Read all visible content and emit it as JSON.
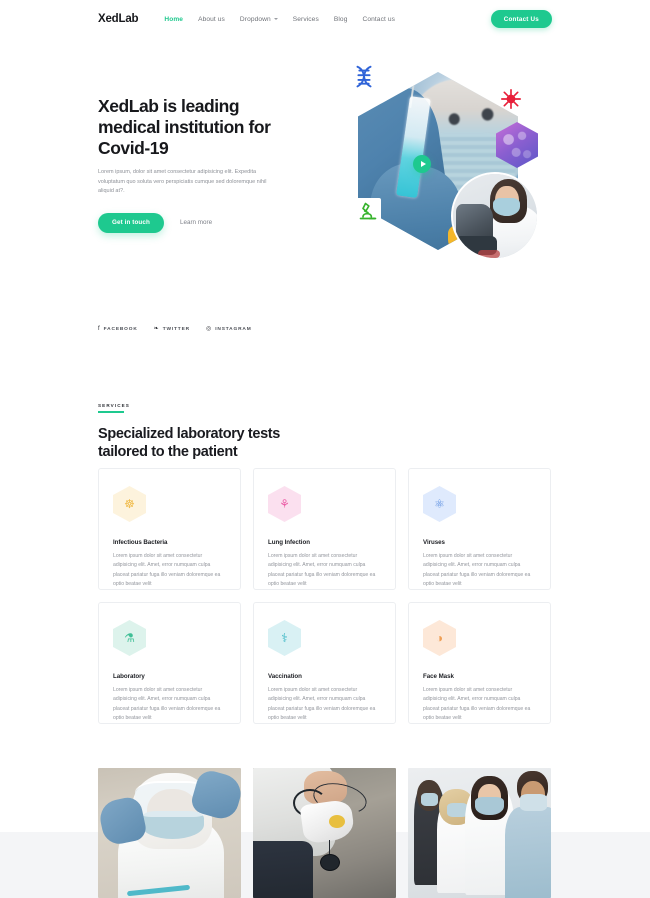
{
  "nav": {
    "logo": "XedLab",
    "links": [
      {
        "label": "Home",
        "active": true
      },
      {
        "label": "About us",
        "active": false
      },
      {
        "label": "Dropdown",
        "active": false,
        "has_chevron": true
      },
      {
        "label": "Services",
        "active": false
      },
      {
        "label": "Blog",
        "active": false
      },
      {
        "label": "Contact us",
        "active": false
      }
    ],
    "cta_label": "Contact Us"
  },
  "hero": {
    "title": "XedLab is leading\nmedical institution for\nCovid-19",
    "paragraph": "Lorem ipsum, dolor sit amet consectetur adipisicing elit. Expedita voluptatum quo soluta vero perspiciatis cumque sed doloremque nihil aliquid at?.",
    "primary_button": "Get in touch",
    "secondary_link": "Learn more",
    "play_icon": "play-icon",
    "art_icons": [
      "dna-icon",
      "virus-icon",
      "microscope-icon",
      "purple-cell-hexagon",
      "doctor-microscope-photo"
    ]
  },
  "socials": [
    {
      "label": "Facebook",
      "icon": "facebook-icon",
      "glyph": "f"
    },
    {
      "label": "Twitter",
      "icon": "twitter-icon",
      "glyph": "❧"
    },
    {
      "label": "Instagram",
      "icon": "instagram-icon",
      "glyph": "◎"
    }
  ],
  "services": {
    "eyebrow": "Services",
    "title": "Specialized laboratory tests\ntailored to the patient",
    "cards": [
      {
        "title": "Infectious Bacteria",
        "text": "Lorem ipsum dolor sit amet consectetur adipisicing elit. Amet, error numquam culpa placeat pariatur fuga illo veniam doloremque ea optio beatae velit",
        "icon": "bacteria-icon",
        "glyph": "☸",
        "hex_color": "#fdf3dd",
        "glyph_color": "#f0bb4a"
      },
      {
        "title": "Lung Infection",
        "text": "Lorem ipsum dolor sit amet consectetur adipisicing elit. Amet, error numquam culpa placeat pariatur fuga illo veniam doloremque ea optio beatae velit",
        "icon": "lungs-icon",
        "glyph": "⚘",
        "hex_color": "#fbe0ef",
        "glyph_color": "#ec5fa8"
      },
      {
        "title": "Viruses",
        "text": "Lorem ipsum dolor sit amet consectetur adipisicing elit. Amet, error numquam culpa placeat pariatur fuga illo veniam doloremque ea optio beatae velit",
        "icon": "virus-icon",
        "glyph": "⚛",
        "hex_color": "#dfeafd",
        "glyph_color": "#5b8ee0"
      },
      {
        "title": "Laboratory",
        "text": "Lorem ipsum dolor sit amet consectetur adipisicing elit. Amet, error numquam culpa placeat pariatur fuga illo veniam doloremque ea optio beatae velit",
        "icon": "test-tubes-icon",
        "glyph": "⚗",
        "hex_color": "#ddf3ec",
        "glyph_color": "#3fbf96"
      },
      {
        "title": "Vaccination",
        "text": "Lorem ipsum dolor sit amet consectetur adipisicing elit. Amet, error numquam culpa placeat pariatur fuga illo veniam doloremque ea optio beatae velit",
        "icon": "syringe-icon",
        "glyph": "⚕",
        "hex_color": "#d9f1f4",
        "glyph_color": "#39b6c4"
      },
      {
        "title": "Face Mask",
        "text": "Lorem ipsum dolor sit amet consectetur adipisicing elit. Amet, error numquam culpa placeat pariatur fuga illo veniam doloremque ea optio beatae velit",
        "icon": "face-mask-icon",
        "glyph": "◑",
        "hex_color": "#fde8d8",
        "glyph_color": "#ef9f55"
      }
    ]
  },
  "gallery": [
    {
      "name": "medical-worker-ppe-photo"
    },
    {
      "name": "n95-mask-in-hand-photo"
    },
    {
      "name": "group-wearing-masks-photo"
    }
  ],
  "colors": {
    "accent": "#1ec98f",
    "heading": "#17181c",
    "muted": "#8d9097",
    "band": "#f4f5f7"
  }
}
